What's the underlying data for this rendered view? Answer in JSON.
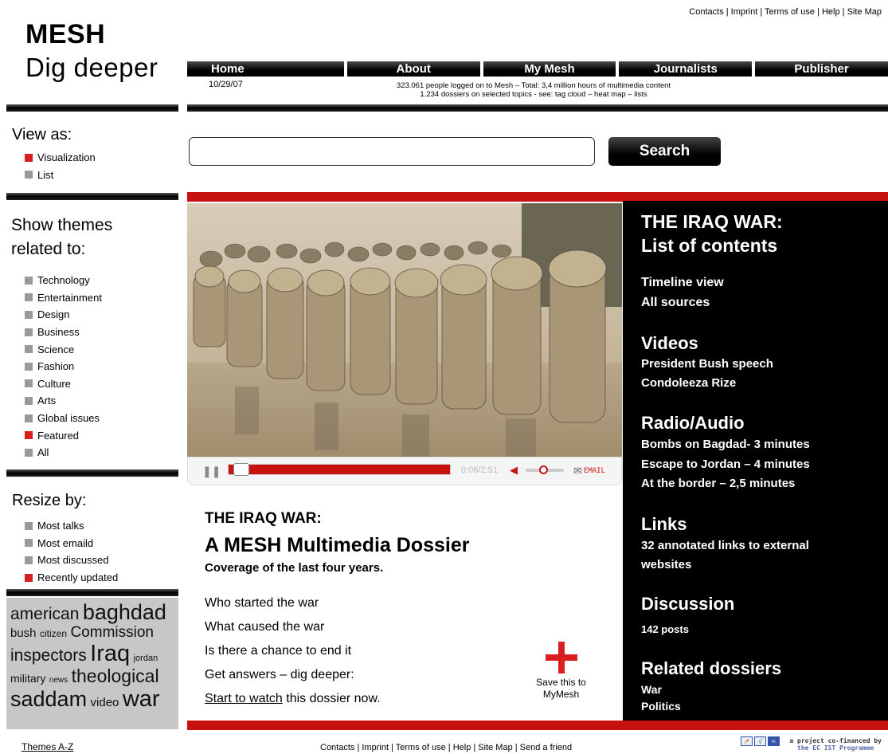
{
  "header": {
    "toplinks": "Contacts  |  Imprint  | Terms of use  | Help  |  Site Map",
    "logo_line1": "MESH",
    "logo_line2": "Dig deeper",
    "nav": [
      "Home",
      "About",
      "My Mesh",
      "Journalists",
      "Publisher"
    ],
    "date": "10/29/07",
    "stats_line1": "323.061 people logged on to Mesh – Total: 3,4 million hours of multimedia content",
    "stats_line2": "1.234 dossiers on selected topics - see: tag cloud – heat map – lists"
  },
  "sidebar": {
    "view_title": "View as:",
    "view_items": [
      {
        "label": "Visualization",
        "active": true
      },
      {
        "label": "List",
        "active": false
      }
    ],
    "themes_title_1": "Show themes",
    "themes_title_2": "related to:",
    "themes": [
      {
        "label": "Technology",
        "active": false
      },
      {
        "label": "Entertainment",
        "active": false
      },
      {
        "label": "Design",
        "active": false
      },
      {
        "label": "Business",
        "active": false
      },
      {
        "label": "Science",
        "active": false
      },
      {
        "label": "Fashion",
        "active": false
      },
      {
        "label": "Culture",
        "active": false
      },
      {
        "label": "Arts",
        "active": false
      },
      {
        "label": "Global issues",
        "active": false
      },
      {
        "label": "Featured",
        "active": true
      },
      {
        "label": "All",
        "active": false
      }
    ],
    "resize_title": "Resize by:",
    "resize_items": [
      {
        "label": "Most talks",
        "active": false
      },
      {
        "label": "Most emaild",
        "active": false
      },
      {
        "label": "Most discussed",
        "active": false
      },
      {
        "label": "Recently updated",
        "active": true
      }
    ],
    "tags": [
      "american",
      "baghdad",
      "bush",
      "citizen",
      "Commission",
      "inspectors",
      "Iraq",
      "jordan",
      "military",
      "news",
      "theological",
      "saddam",
      "video",
      "war"
    ],
    "themes_az": "Themes A-Z"
  },
  "search": {
    "value": "",
    "button_label": "Search"
  },
  "player": {
    "time": "0:06/2:51",
    "email_label": "EMAIL",
    "progress": 0.035
  },
  "dossier": {
    "title1": "THE IRAQ WAR:",
    "title2": "A MESH Multimedia Dossier",
    "subtitle": "Coverage of the last four years.",
    "questions": [
      "Who started the war",
      "What caused the war",
      "Is there a chance to end it",
      "Get answers – dig deeper:"
    ],
    "watch_link": "Start to watch",
    "watch_rest": " this dossier now.",
    "save_line1": "Save this to",
    "save_line2": "MyMesh"
  },
  "contents": {
    "title1": "THE IRAQ WAR:",
    "title2": "List of contents",
    "timeline": "Timeline view",
    "all_sources": "All sources",
    "videos_title": "Videos",
    "videos": [
      "President Bush speech",
      "Condoleeza Rize"
    ],
    "radio_title": "Radio/Audio",
    "radio": [
      "Bombs on Bagdad- 3 minutes",
      "Escape to Jordan – 4 minutes",
      "At the border – 2,5 minutes"
    ],
    "links_title": "Links",
    "links_text1": "32 annotated links to external",
    "links_text2": "websites",
    "discussion_title": "Discussion",
    "discussion_text": "142 posts",
    "related_title": "Related dossiers",
    "related": [
      "War",
      "Politics"
    ]
  },
  "footer": {
    "links": "Contacts  |  Imprint  | Terms of use  | Help  |  Site Map  |  Send a friend",
    "cofinanced_1": "a project co-financed by",
    "cofinanced_2": "the EC IST Programme"
  },
  "colors": {
    "accent": "#c8120f",
    "square_inactive": "#999999",
    "square_active": "#d81e1e"
  }
}
